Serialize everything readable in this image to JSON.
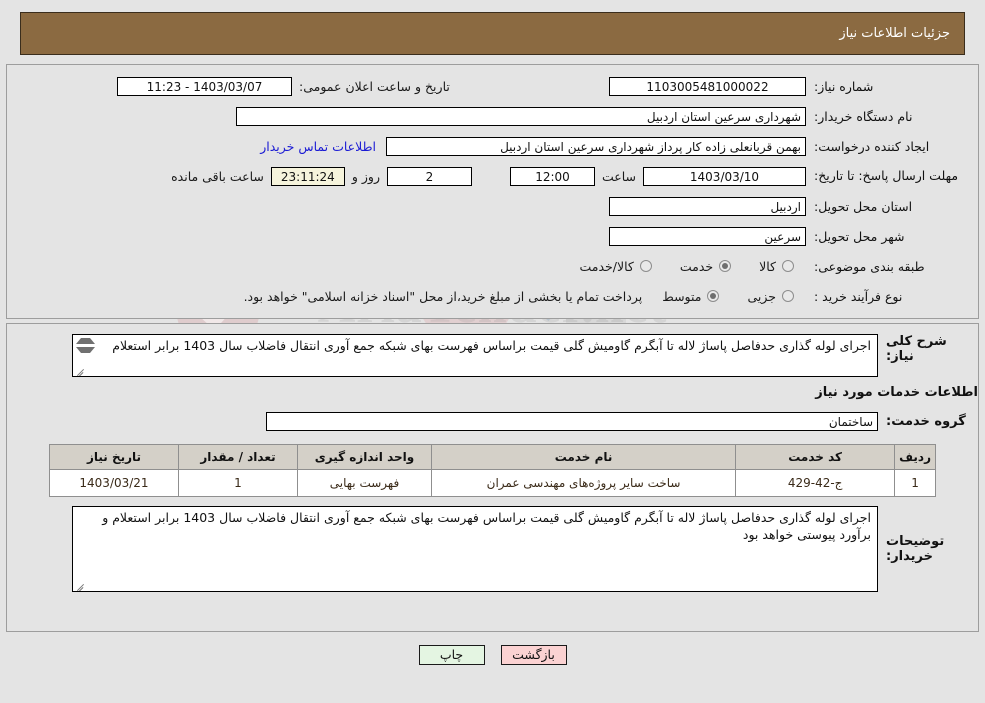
{
  "header": {
    "title": "جزئیات اطلاعات نیاز"
  },
  "need_info": {
    "need_number": {
      "label": "شماره نیاز:",
      "value": "1103005481000022"
    },
    "announce_datetime": {
      "label": "تاریخ و ساعت اعلان عمومی:",
      "value": "1403/03/07 - 11:23"
    },
    "buyer_org": {
      "label": "نام دستگاه خریدار:",
      "value": "شهرداری سرعین استان اردبیل"
    },
    "requester": {
      "label": "ایجاد کننده درخواست:",
      "value": "بهمن قربانعلی زاده کار پرداز شهرداری سرعین استان اردبیل"
    },
    "contact_link": "اطلاعات تماس خریدار",
    "deadline": {
      "label": "مهلت ارسال پاسخ: تا تاریخ:",
      "date": "1403/03/10",
      "time_label": "ساعت",
      "time": "12:00",
      "days": "2",
      "days_label": "روز و",
      "countdown": "23:11:24",
      "remaining_label": "ساعت باقی مانده"
    },
    "delivery_province": {
      "label": "استان محل تحویل:",
      "value": "اردبیل"
    },
    "delivery_city": {
      "label": "شهر محل تحویل:",
      "value": "سرعین"
    },
    "category": {
      "label": "طبقه بندی موضوعی:",
      "options": [
        "کالا",
        "خدمت",
        "کالا/خدمت"
      ],
      "selected": "خدمت"
    },
    "purchase_type": {
      "label": "نوع فرآیند خرید :",
      "options": [
        "جزیی",
        "متوسط"
      ],
      "selected": "متوسط",
      "note": "پرداخت تمام یا بخشی از مبلغ خرید،از محل \"اسناد خزانه اسلامی\" خواهد بود."
    }
  },
  "summary": {
    "label": "شرح کلی نیاز:",
    "value": "اجرای لوله گذاری حدفاصل پاساژ لاله تا آبگرم گاومیش گلی قیمت براساس فهرست بهای شبکه جمع آوری انتقال فاضلاب سال 1403 برابر استعلام"
  },
  "services_section": {
    "title": "اطلاعات خدمات مورد نیاز",
    "service_group": {
      "label": "گروه خدمت:",
      "value": "ساختمان"
    },
    "table": {
      "columns": [
        "ردیف",
        "کد خدمت",
        "نام خدمت",
        "واحد اندازه گیری",
        "تعداد / مقدار",
        "تاریخ نیاز"
      ],
      "rows": [
        {
          "radif": "1",
          "code": "ج-42-429",
          "name": "ساخت سایر پروژه‌های مهندسی عمران",
          "unit": "فهرست بهایی",
          "qty": "1",
          "date": "1403/03/21"
        }
      ]
    }
  },
  "buyer_notes": {
    "label": "توضیحات خریدار:",
    "value": "اجرای لوله گذاری حدفاصل پاساژ لاله تا آبگرم گاومیش گلی قیمت براساس فهرست بهای شبکه جمع آوری انتقال فاضلاب سال 1403 برابر استعلام و برآورد پیوستی خواهد بود"
  },
  "footer": {
    "print_label": "چاپ",
    "back_label": "بازگشت"
  },
  "watermark": {
    "text": "AriaTender.net"
  },
  "colors": {
    "header_bg": "#8b6a41",
    "link": "#1b1bd4",
    "countdown_bg": "#f6f4dc",
    "print_bg": "#e4f5e2",
    "back_bg": "#fbd2d2",
    "table_header_bg": "#d4d0c8"
  }
}
